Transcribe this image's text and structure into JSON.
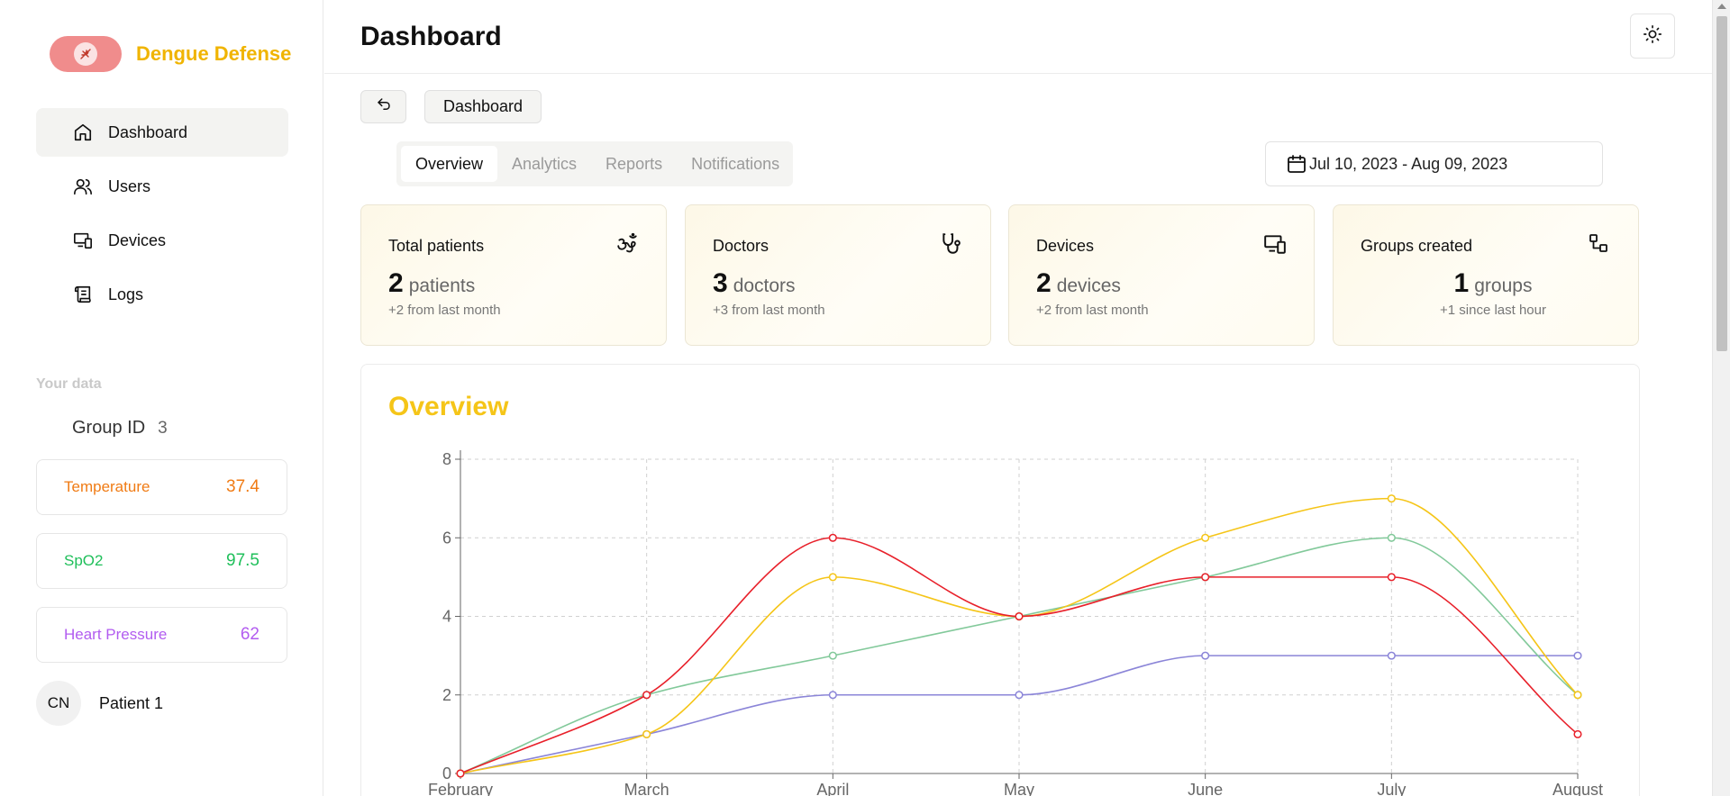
{
  "brand": {
    "name": "Dengue Defense",
    "accent": "#f0b400",
    "logo_bg": "#f08c8c",
    "logo_icon": "mosquito-icon"
  },
  "sidebar": {
    "items": [
      {
        "label": "Dashboard",
        "icon": "home-icon",
        "active": true
      },
      {
        "label": "Users",
        "icon": "users-icon",
        "active": false
      },
      {
        "label": "Devices",
        "icon": "devices-icon",
        "active": false
      },
      {
        "label": "Logs",
        "icon": "scroll-icon",
        "active": false
      }
    ],
    "section_label": "Your data",
    "group_label": "Group ID",
    "group_value": "3",
    "metrics": [
      {
        "label": "Temperature",
        "value": "37.4",
        "color": "#f07b14"
      },
      {
        "label": "SpO2",
        "value": "97.5",
        "color": "#1fbf5a"
      },
      {
        "label": "Heart Pressure",
        "value": "62",
        "color": "#b25cf0"
      }
    ],
    "patient": {
      "initials": "CN",
      "name": "Patient 1"
    }
  },
  "header": {
    "title": "Dashboard",
    "theme_icon": "sun-icon"
  },
  "breadcrumb": {
    "back_icon": "undo-icon",
    "label": "Dashboard"
  },
  "tabs": [
    {
      "label": "Overview",
      "active": true
    },
    {
      "label": "Analytics",
      "active": false
    },
    {
      "label": "Reports",
      "active": false
    },
    {
      "label": "Notifications",
      "active": false
    }
  ],
  "date_range": {
    "label": "Jul 10, 2023 - Aug 09, 2023",
    "icon": "calendar-icon"
  },
  "stats": [
    {
      "title": "Total patients",
      "value": "2",
      "unit": "patients",
      "sub": "+2 from last month",
      "icon": "om-icon"
    },
    {
      "title": "Doctors",
      "value": "3",
      "unit": "doctors",
      "sub": "+3 from last month",
      "icon": "stethoscope-icon"
    },
    {
      "title": "Devices",
      "value": "2",
      "unit": "devices",
      "sub": "+2 from last month",
      "icon": "devices-icon"
    },
    {
      "title": "Groups created",
      "value": "1",
      "unit": "groups",
      "sub": "+1 since last hour",
      "icon": "group-icon"
    }
  ],
  "overview": {
    "title": "Overview",
    "title_color": "#f5c518"
  },
  "chart_data": {
    "type": "line",
    "categories": [
      "February",
      "March",
      "April",
      "May",
      "June",
      "July",
      "August"
    ],
    "ylim": [
      0,
      8
    ],
    "yticks": [
      0,
      2,
      4,
      6,
      8
    ],
    "grid": true,
    "series": [
      {
        "values": [
          0,
          2,
          6,
          4,
          5,
          5,
          1
        ],
        "color": "#e8202a"
      },
      {
        "values": [
          0,
          1,
          5,
          4,
          6,
          7,
          2
        ],
        "color": "#f5c518"
      },
      {
        "values": [
          0,
          2,
          3,
          4,
          5,
          6,
          2
        ],
        "color": "#82c99a"
      },
      {
        "values": [
          0,
          1,
          2,
          2,
          3,
          3,
          3
        ],
        "color": "#8b85d8"
      }
    ]
  }
}
